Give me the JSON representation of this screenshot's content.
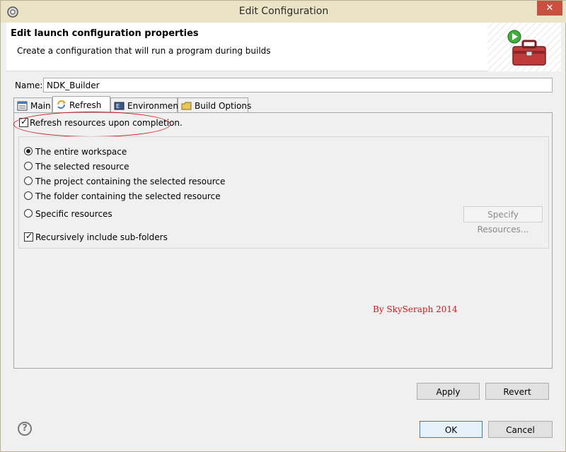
{
  "window": {
    "title": "Edit Configuration",
    "close_glyph": "✕"
  },
  "header": {
    "title": "Edit launch configuration properties",
    "subtitle": "Create a configuration that will run a program during builds"
  },
  "name": {
    "label": "Name:",
    "value": "NDK_Builder"
  },
  "tabs": [
    {
      "label": "Main",
      "icon": "main-tab-icon"
    },
    {
      "label": "Refresh",
      "icon": "refresh-tab-icon",
      "active": true
    },
    {
      "label": "Environment",
      "icon": "environment-tab-icon"
    },
    {
      "label": "Build Options",
      "icon": "build-options-tab-icon"
    }
  ],
  "refresh": {
    "refresh_on_completion_label": "Refresh resources upon completion.",
    "refresh_on_completion_checked": true,
    "scope_options": [
      {
        "label": "The entire workspace",
        "checked": true
      },
      {
        "label": "The selected resource",
        "checked": false
      },
      {
        "label": "The project containing the selected resource",
        "checked": false
      },
      {
        "label": "The folder containing the selected resource",
        "checked": false
      },
      {
        "label": "Specific resources",
        "checked": false
      }
    ],
    "specify_resources_label": "Specify Resources...",
    "recursive_label": "Recursively include sub-folders",
    "recursive_checked": true
  },
  "watermark": "By SkySeraph 2014",
  "buttons": {
    "apply": "Apply",
    "revert": "Revert",
    "ok": "OK",
    "cancel": "Cancel",
    "help_glyph": "?"
  },
  "colors": {
    "annotation_red": "#c8191e",
    "title_bar": "#ebe3c6",
    "close_button": "#c7503e",
    "default_button_border": "#3c7fb1"
  }
}
